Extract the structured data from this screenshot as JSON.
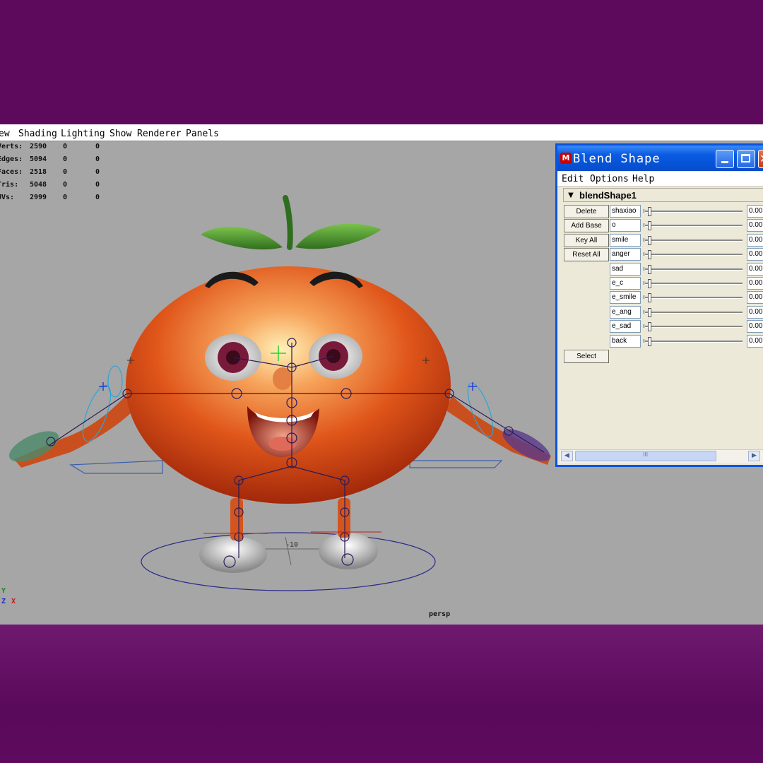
{
  "menubar": {
    "items": [
      "ew",
      "Shading",
      "Lighting",
      "Show",
      "Renderer",
      "Panels"
    ]
  },
  "hud": {
    "rows": [
      {
        "label": "Verts:",
        "value": "2590",
        "sel": "0",
        "comp": "0"
      },
      {
        "label": "Edges:",
        "value": "5094",
        "sel": "0",
        "comp": "0"
      },
      {
        "label": "Faces:",
        "value": "2518",
        "sel": "0",
        "comp": "0"
      },
      {
        "label": "Tris:",
        "value": "5048",
        "sel": "0",
        "comp": "0"
      },
      {
        "label": "UVs:",
        "value": "2999",
        "sel": "0",
        "comp": "0"
      }
    ]
  },
  "viewport": {
    "camera": "persp",
    "grid_label": "-10",
    "axes": {
      "y": "Y",
      "z": "Z",
      "x": "X"
    }
  },
  "blend_shape": {
    "title": "Blend Shape",
    "menu": [
      "Edit",
      "Options",
      "Help"
    ],
    "node": "blendShape1",
    "buttons": {
      "delete": "Delete",
      "add_base": "Add Base",
      "key_all": "Key All",
      "reset_all": "Reset All",
      "select": "Select"
    },
    "targets": [
      {
        "name": "shaxiao",
        "value": "0.00"
      },
      {
        "name": "o",
        "value": "0.00"
      },
      {
        "name": "smile",
        "value": "0.00"
      },
      {
        "name": "anger",
        "value": "0.00"
      },
      {
        "name": "sad",
        "value": "0.00"
      },
      {
        "name": "e_c",
        "value": "0.00"
      },
      {
        "name": "e_smile",
        "value": "0.00"
      },
      {
        "name": "e_ang",
        "value": "0.00"
      },
      {
        "name": "e_sad",
        "value": "0.00"
      },
      {
        "name": "back",
        "value": "0.00"
      }
    ],
    "scroll_track": "III"
  },
  "colors": {
    "background_purple": "#5e0a5e",
    "viewport_gray": "#a6a6a6",
    "titlebar_blue": "#0553d8",
    "tomato_orange": "#e0561a"
  }
}
